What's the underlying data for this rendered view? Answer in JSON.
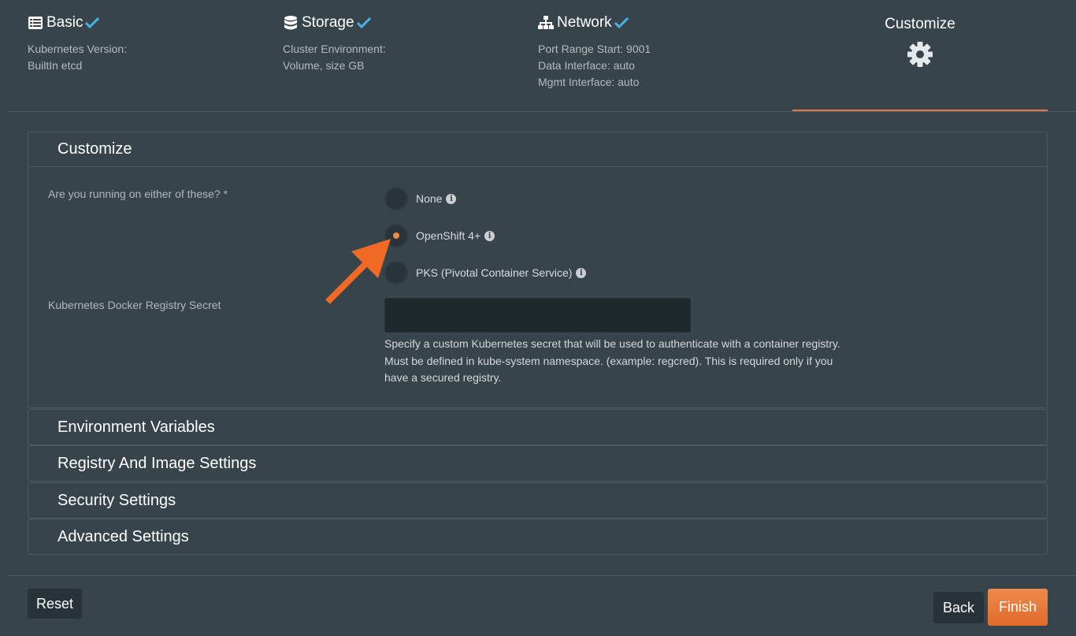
{
  "steps": [
    {
      "title": "Basic",
      "icon": "list-icon",
      "complete": true,
      "lines": [
        "Kubernetes Version:",
        "BuiltIn etcd"
      ]
    },
    {
      "title": "Storage",
      "icon": "database-icon",
      "complete": true,
      "lines": [
        "Cluster Environment:",
        "Volume, size GB"
      ]
    },
    {
      "title": "Network",
      "icon": "sitemap-icon",
      "complete": true,
      "lines": [
        "Port Range Start: 9001",
        "Data Interface: auto",
        "Mgmt Interface: auto"
      ]
    },
    {
      "title": "Customize",
      "icon": "gear-icon",
      "active": true
    }
  ],
  "customize": {
    "title": "Customize",
    "question": "Are you running on either of these? *",
    "options": [
      {
        "label": "None",
        "selected": false
      },
      {
        "label": "OpenShift 4+",
        "selected": true
      },
      {
        "label": "PKS (Pivotal Container Service)",
        "selected": false
      }
    ],
    "secret_label": "Kubernetes Docker Registry Secret",
    "secret_value": "",
    "secret_help": "Specify a custom Kubernetes secret that will be used to authenticate with a container registry. Must be defined in kube-system namespace. (example: regcred). This is required only if you have a secured registry."
  },
  "sections": [
    "Environment Variables",
    "Registry And Image Settings",
    "Security Settings",
    "Advanced Settings"
  ],
  "buttons": {
    "reset": "Reset",
    "back": "Back",
    "finish": "Finish"
  },
  "colors": {
    "accent": "#e87a3c",
    "check": "#4ab3e6",
    "background": "#37444b"
  }
}
